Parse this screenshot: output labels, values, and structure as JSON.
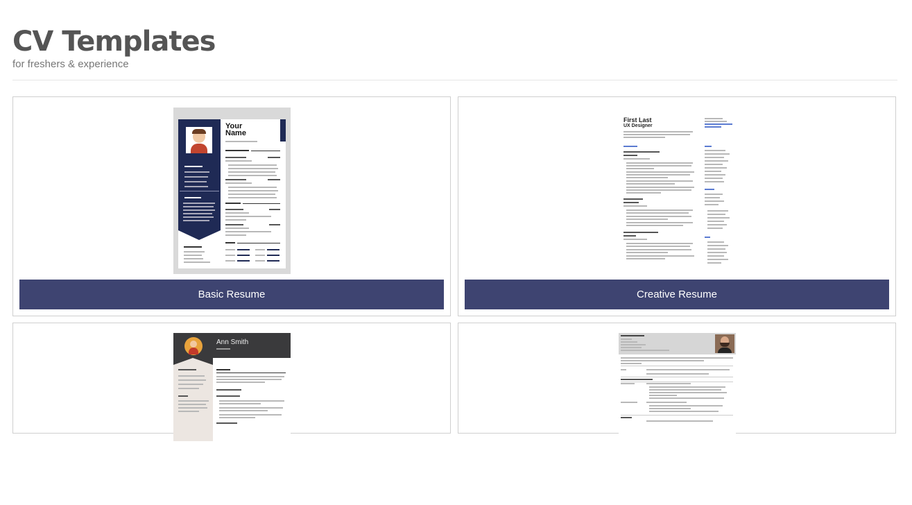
{
  "header": {
    "title": "CV Templates",
    "subtitle": "for freshers & experience"
  },
  "templates": [
    {
      "button_label": "Basic Resume",
      "preview": {
        "name_line1": "Your",
        "name_line2": "Name"
      }
    },
    {
      "button_label": "Creative Resume",
      "preview": {
        "name": "First Last",
        "role": "UX Designer"
      }
    },
    {
      "button_label": "",
      "preview": {
        "name": "Ann Smith"
      }
    },
    {
      "button_label": "",
      "preview": {}
    }
  ],
  "colors": {
    "button_bg": "#3e4471",
    "navy": "#1f2a55",
    "title": "#555555"
  }
}
